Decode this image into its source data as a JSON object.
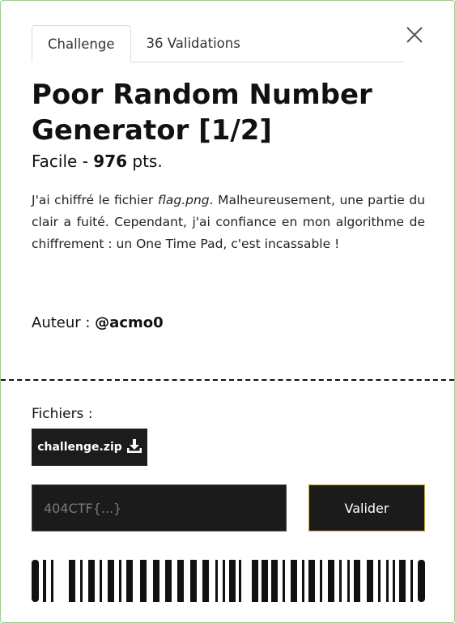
{
  "tabs": [
    {
      "label": "Challenge",
      "active": true
    },
    {
      "label": "36 Validations",
      "active": false
    }
  ],
  "challenge": {
    "title": "Poor Random Number Generator [1/2]",
    "difficulty": "Facile",
    "separator": " - ",
    "points": "976",
    "points_unit": " pts.",
    "description_before": "J'ai chiffré le fichier ",
    "description_file": "flag.png",
    "description_after": ". Malheureusement, une partie du clair a fuité. Cependant, j'ai confiance en mon algorithme de chiffrement : un One Time Pad, c'est incassable !",
    "author_label": "Auteur : ",
    "author": "@acmo0"
  },
  "files": {
    "label": "Fichiers :",
    "items": [
      {
        "name": "challenge.zip",
        "icon": "download-icon"
      }
    ]
  },
  "flag_form": {
    "placeholder": "404CTF{...}",
    "value": "",
    "submit_label": "Valider"
  },
  "colors": {
    "border": "#9ccc8a",
    "dark": "#1b1b1b",
    "submit_border": "#c9a43a"
  }
}
